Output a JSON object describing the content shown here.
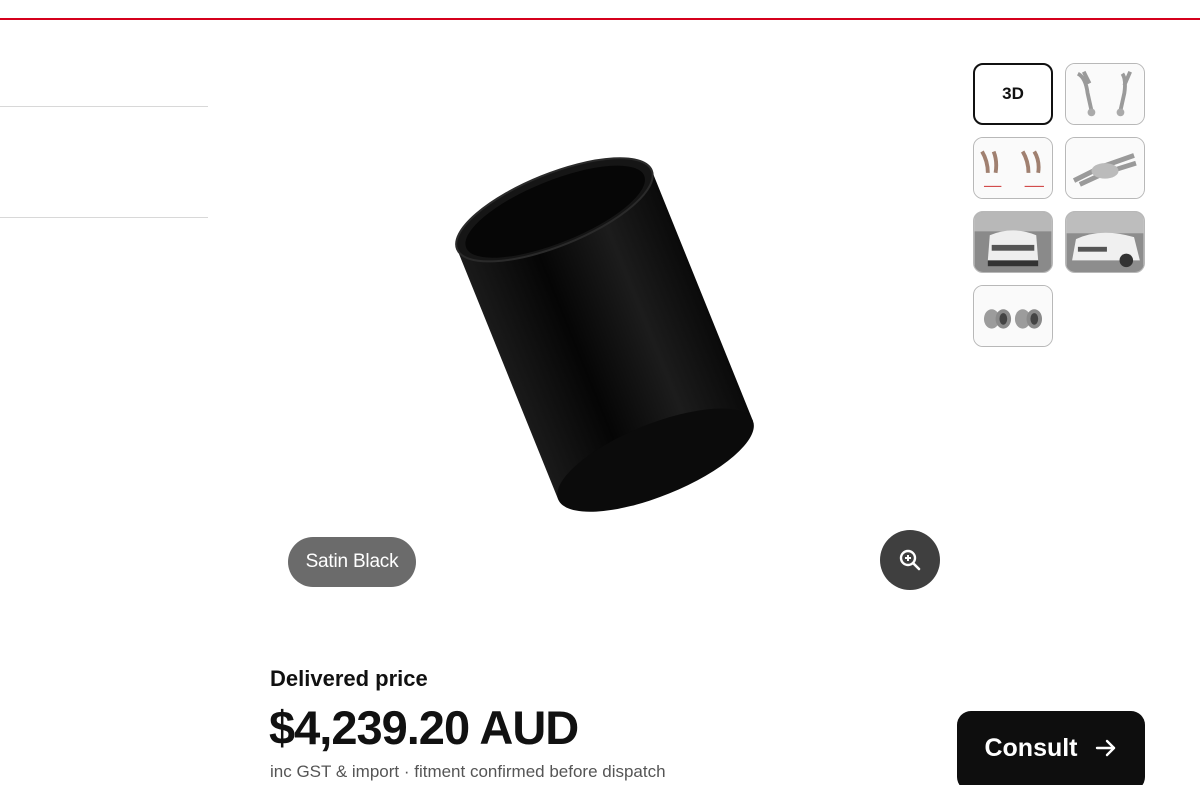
{
  "header": {
    "accent_color": "#d5001c"
  },
  "gallery": {
    "thumbnails": [
      {
        "label": "3D",
        "kind": "3d-view",
        "active": true
      },
      {
        "kind": "exhaust-system-photo"
      },
      {
        "kind": "exhaust-diagram-photo"
      },
      {
        "kind": "exhaust-muffler-photo"
      },
      {
        "kind": "car-rear-photo"
      },
      {
        "kind": "car-rear-angle-photo"
      },
      {
        "kind": "exhaust-tips-photo"
      }
    ]
  },
  "viewer": {
    "product": "exhaust-tip-3d-model",
    "variant_label": "Satin Black",
    "zoom_icon": "zoom-in-icon"
  },
  "pricing": {
    "label": "Delivered price",
    "value": "$4,239.20 AUD",
    "note": "inc GST & import · fitment confirmed before dispatch"
  },
  "actions": {
    "consult_label": "Consult",
    "consult_icon": "arrow-right-icon"
  }
}
